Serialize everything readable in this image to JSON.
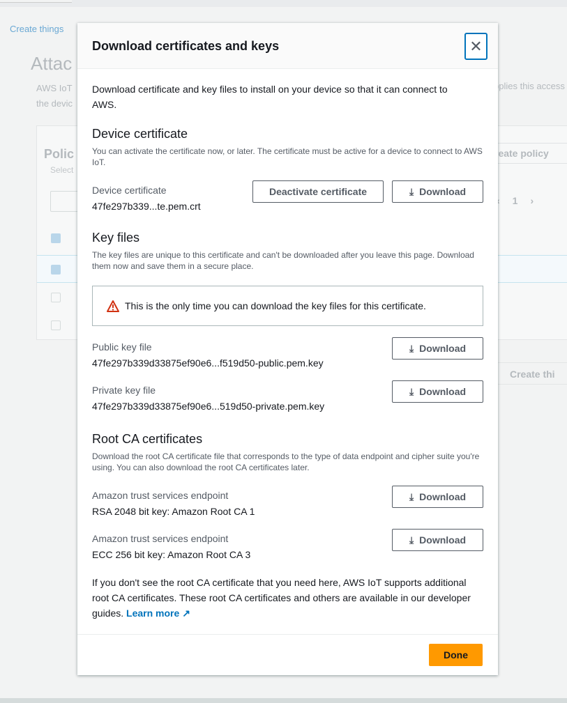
{
  "background": {
    "breadcrumb": "Create things",
    "title": "Attac",
    "desc_left_1": "AWS IoT",
    "desc_left_2": "the devic",
    "desc_right": "pplies this access",
    "panel_title": "Polic",
    "panel_sub": "Select",
    "create_policy": "reate policy",
    "page": "1",
    "create_thing": "Create thi"
  },
  "modal": {
    "title": "Download certificates and keys",
    "close_icon": "close-icon",
    "intro": "Download certificate and key files to install on your device so that it can connect to AWS.",
    "device": {
      "heading": "Device certificate",
      "desc": "You can activate the certificate now, or later. The certificate must be active for a device to connect to AWS IoT.",
      "label": "Device certificate",
      "value": "47fe297b339...te.pem.crt",
      "deactivate": "Deactivate certificate",
      "download": "Download"
    },
    "keys": {
      "heading": "Key files",
      "desc": "The key files are unique to this certificate and can't be downloaded after you leave this page. Download them now and save them in a secure place.",
      "alert": "This is the only time you can download the key files for this certificate.",
      "alert_icon": "warning-icon",
      "items": [
        {
          "label": "Public key file",
          "value": "47fe297b339d33875ef90e6...f519d50-public.pem.key",
          "download": "Download"
        },
        {
          "label": "Private key file",
          "value": "47fe297b339d33875ef90e6...519d50-private.pem.key",
          "download": "Download"
        }
      ]
    },
    "root": {
      "heading": "Root CA certificates",
      "desc": "Download the root CA certificate file that corresponds to the type of data endpoint and cipher suite you're using. You can also download the root CA certificates later.",
      "items": [
        {
          "label": "Amazon trust services endpoint",
          "value": "RSA 2048 bit key: Amazon Root CA 1",
          "download": "Download"
        },
        {
          "label": "Amazon trust services endpoint",
          "value": "ECC 256 bit key: Amazon Root CA 3",
          "download": "Download"
        }
      ],
      "note": "If you don't see the root CA certificate that you need here, AWS IoT supports additional root CA certificates. These root CA certificates and others are available in our developer guides.",
      "learn_more": "Learn more"
    },
    "done": "Done"
  },
  "colors": {
    "accent": "#0073bb",
    "primary": "#ff9900",
    "warning": "#d13212"
  }
}
